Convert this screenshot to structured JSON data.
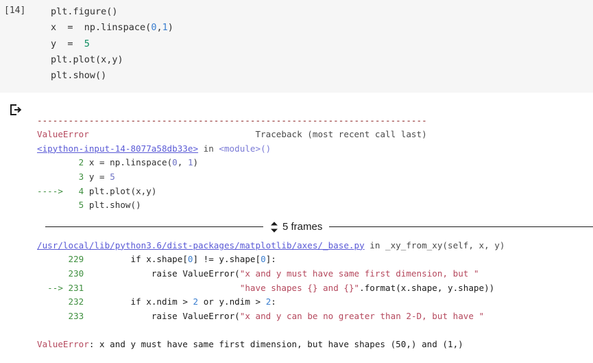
{
  "notebook": {
    "cell": {
      "prompt": "[14]",
      "code_lines": [
        [
          {
            "t": "plt.figure()",
            "c": "plain"
          }
        ],
        [
          {
            "t": "x  =  np.linspace(",
            "c": "plain"
          },
          {
            "t": "0",
            "c": "num2"
          },
          {
            "t": ",",
            "c": "plain"
          },
          {
            "t": "1",
            "c": "num2"
          },
          {
            "t": ")",
            "c": "plain"
          }
        ],
        [
          {
            "t": "y  =  ",
            "c": "plain"
          },
          {
            "t": "5",
            "c": "green"
          }
        ],
        [
          {
            "t": "plt.plot(x,y)",
            "c": "plain"
          }
        ],
        [
          {
            "t": "plt.show()",
            "c": "plain"
          }
        ]
      ]
    },
    "output": {
      "icon": "output-arrow-icon",
      "divider_dashes": "---------------------------------------------------------------------------",
      "header": {
        "exception": "ValueError",
        "traceback_note": "Traceback (most recent call last)"
      },
      "frame_1": {
        "location": "<ipython-input-14-8077a58db33e>",
        "in_word": "in",
        "function": "<module>",
        "args": "()",
        "lines": [
          {
            "marker": "",
            "no": "2",
            "parts": [
              {
                "t": "x = np.linspace(",
                "c": "plain"
              },
              {
                "t": "0",
                "c": "num"
              },
              {
                "t": ", ",
                "c": "plain"
              },
              {
                "t": "1",
                "c": "num"
              },
              {
                "t": ")",
                "c": "plain"
              }
            ]
          },
          {
            "marker": "",
            "no": "3",
            "parts": [
              {
                "t": "y = ",
                "c": "plain"
              },
              {
                "t": "5",
                "c": "num"
              }
            ]
          },
          {
            "marker": "----> ",
            "no": "4",
            "parts": [
              {
                "t": "plt.plot(x,y)",
                "c": "plain"
              }
            ]
          },
          {
            "marker": "",
            "no": "5",
            "parts": [
              {
                "t": "plt.show()",
                "c": "plain"
              }
            ]
          }
        ]
      },
      "frames_toggle": {
        "label": "5 frames",
        "icon": "expand-collapse-chevrons-icon"
      },
      "frame_2": {
        "path": "/usr/local/lib/python3.6/dist-packages/matplotlib/axes/_base.py",
        "in_word": "in",
        "function": "_xy_from_xy(self, x, y)",
        "lines": [
          {
            "marker": "",
            "no": "229",
            "indent": "        ",
            "parts": [
              {
                "t": "if x.shape[",
                "c": "dark"
              },
              {
                "t": "0",
                "c": "num2"
              },
              {
                "t": "] != y.shape[",
                "c": "dark"
              },
              {
                "t": "0",
                "c": "num2"
              },
              {
                "t": "]:",
                "c": "dark"
              }
            ]
          },
          {
            "marker": "",
            "no": "230",
            "indent": "            ",
            "parts": [
              {
                "t": "raise ValueError(",
                "c": "dark"
              },
              {
                "t": "\"x and y must have same first dimension, but \"",
                "c": "str"
              }
            ]
          },
          {
            "marker": "--> ",
            "no": "231",
            "indent": "                             ",
            "parts": [
              {
                "t": "\"have shapes {} and {}\"",
                "c": "str"
              },
              {
                "t": ".format(x.shape, y.shape))",
                "c": "dark"
              }
            ]
          },
          {
            "marker": "",
            "no": "232",
            "indent": "        ",
            "parts": [
              {
                "t": "if x.ndim > ",
                "c": "dark"
              },
              {
                "t": "2",
                "c": "num2"
              },
              {
                "t": " or y.ndim > ",
                "c": "dark"
              },
              {
                "t": "2",
                "c": "num2"
              },
              {
                "t": ":",
                "c": "dark"
              }
            ]
          },
          {
            "marker": "",
            "no": "233",
            "indent": "            ",
            "parts": [
              {
                "t": "raise ValueError(",
                "c": "dark"
              },
              {
                "t": "\"x and y can be no greater than 2-D, but have \"",
                "c": "str"
              }
            ]
          }
        ]
      },
      "final": {
        "exception": "ValueError",
        "message": ": x and y must have same first dimension, but have shapes (50,) and (1,)"
      }
    }
  },
  "colors": {
    "cell_background": "#f6f6f6",
    "error_red": "#a31515",
    "error_name": "#b5485d",
    "link_blue": "#5a5ad6",
    "lineno_green": "#3f8f3f",
    "number_purple": "#6c71c4"
  }
}
